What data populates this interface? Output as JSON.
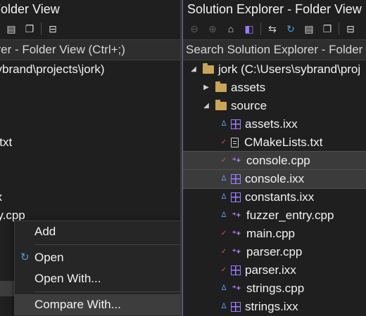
{
  "left_pane": {
    "title": "Folder View",
    "search_placeholder": "orer - Folder View (Ctrl+;)",
    "tree": [
      {
        "label": "sybrand\\projects\\jork)"
      },
      {
        "label": ""
      },
      {
        "label": ""
      },
      {
        "label": ""
      },
      {
        "label": "s.txt"
      },
      {
        "label": "p"
      },
      {
        "label": ""
      },
      {
        "label": "xx"
      },
      {
        "label": "try.cpp"
      }
    ],
    "context_menu": {
      "items": [
        {
          "label": "Add",
          "icon": ""
        },
        {
          "label": "Open",
          "icon": "refresh-open-icon"
        },
        {
          "label": "Open With...",
          "icon": ""
        },
        {
          "label": "Compare With...",
          "icon": ""
        }
      ]
    }
  },
  "right_pane": {
    "title": "Solution Explorer - Folder View",
    "search_placeholder": "Search Solution Explorer - Folder",
    "tree": [
      {
        "label": "jork (C:\\Users\\sybrand\\proj",
        "type": "folder",
        "arrow": "▲",
        "status": "",
        "level": 0
      },
      {
        "label": "assets",
        "type": "folder",
        "arrow": "▶",
        "status": "",
        "level": 1
      },
      {
        "label": "source",
        "type": "folder",
        "arrow": "◢",
        "status": "",
        "level": 1
      },
      {
        "label": "assets.ixx",
        "type": "module",
        "arrow": "",
        "status": "lock",
        "level": 2
      },
      {
        "label": "CMakeLists.txt",
        "type": "txt",
        "arrow": "",
        "status": "check",
        "level": 2
      },
      {
        "label": "console.cpp",
        "type": "cpp",
        "arrow": "",
        "status": "check",
        "level": 2,
        "selected": true
      },
      {
        "label": "console.ixx",
        "type": "module",
        "arrow": "",
        "status": "lock",
        "level": 2,
        "selected": true
      },
      {
        "label": "constants.ixx",
        "type": "module",
        "arrow": "",
        "status": "lock",
        "level": 2
      },
      {
        "label": "fuzzer_entry.cpp",
        "type": "cpp",
        "arrow": "",
        "status": "lock",
        "level": 2
      },
      {
        "label": "main.cpp",
        "type": "cpp",
        "arrow": "",
        "status": "check",
        "level": 2
      },
      {
        "label": "parser.cpp",
        "type": "cpp",
        "arrow": "",
        "status": "check",
        "level": 2
      },
      {
        "label": "parser.ixx",
        "type": "module",
        "arrow": "",
        "status": "check",
        "level": 2
      },
      {
        "label": "strings.cpp",
        "type": "cpp",
        "arrow": "",
        "status": "lock",
        "level": 2
      },
      {
        "label": "strings.ixx",
        "type": "module",
        "arrow": "",
        "status": "lock",
        "level": 2
      }
    ]
  },
  "colors": {
    "background": "#1f1f1f",
    "folder": "#c9a657",
    "module": "#9a7cff",
    "lock": "#4d9de0",
    "check": "#d9534f",
    "selection": "#3b3b3b"
  }
}
